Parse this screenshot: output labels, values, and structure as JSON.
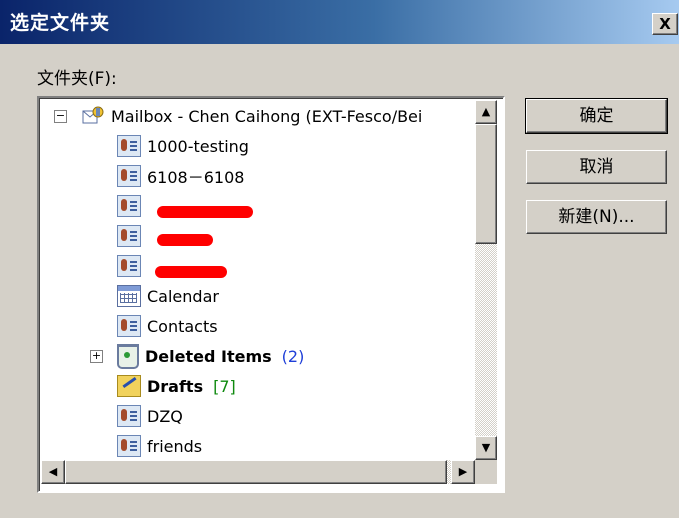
{
  "dialog": {
    "title": "选定文件夹",
    "close_label": "X",
    "folder_label": "文件夹(F):"
  },
  "buttons": {
    "ok": "确定",
    "cancel": "取消",
    "new": "新建(N)..."
  },
  "tree": {
    "root": {
      "label": "Mailbox - Chen Caihong (EXT-Fesco/Bei",
      "expander": "−",
      "icon": "mailbox-icon"
    },
    "items": [
      {
        "label": "1000-testing",
        "icon": "contact-folder-icon"
      },
      {
        "label": "6108－6108",
        "icon": "contact-folder-icon"
      },
      {
        "label": "",
        "icon": "contact-folder-icon",
        "redacted": true
      },
      {
        "label": "",
        "icon": "contact-folder-icon",
        "redacted": true
      },
      {
        "label": "",
        "icon": "contact-folder-icon",
        "redacted": true
      },
      {
        "label": "Calendar",
        "icon": "calendar-icon"
      },
      {
        "label": "Contacts",
        "icon": "contact-folder-icon"
      },
      {
        "label": "Deleted Items",
        "icon": "deleted-items-icon",
        "bold": true,
        "count": "(2)",
        "count_color": "#1f3fd8",
        "expander": "+"
      },
      {
        "label": "Drafts",
        "icon": "drafts-icon",
        "bold": true,
        "count": "[7]",
        "count_color": "#0f8a0f"
      },
      {
        "label": "DZQ",
        "icon": "contact-folder-icon"
      },
      {
        "label": "friends",
        "icon": "contact-folder-icon"
      }
    ]
  },
  "scrollbars": {
    "up": "▲",
    "down": "▼",
    "left": "◀",
    "right": "▶"
  }
}
